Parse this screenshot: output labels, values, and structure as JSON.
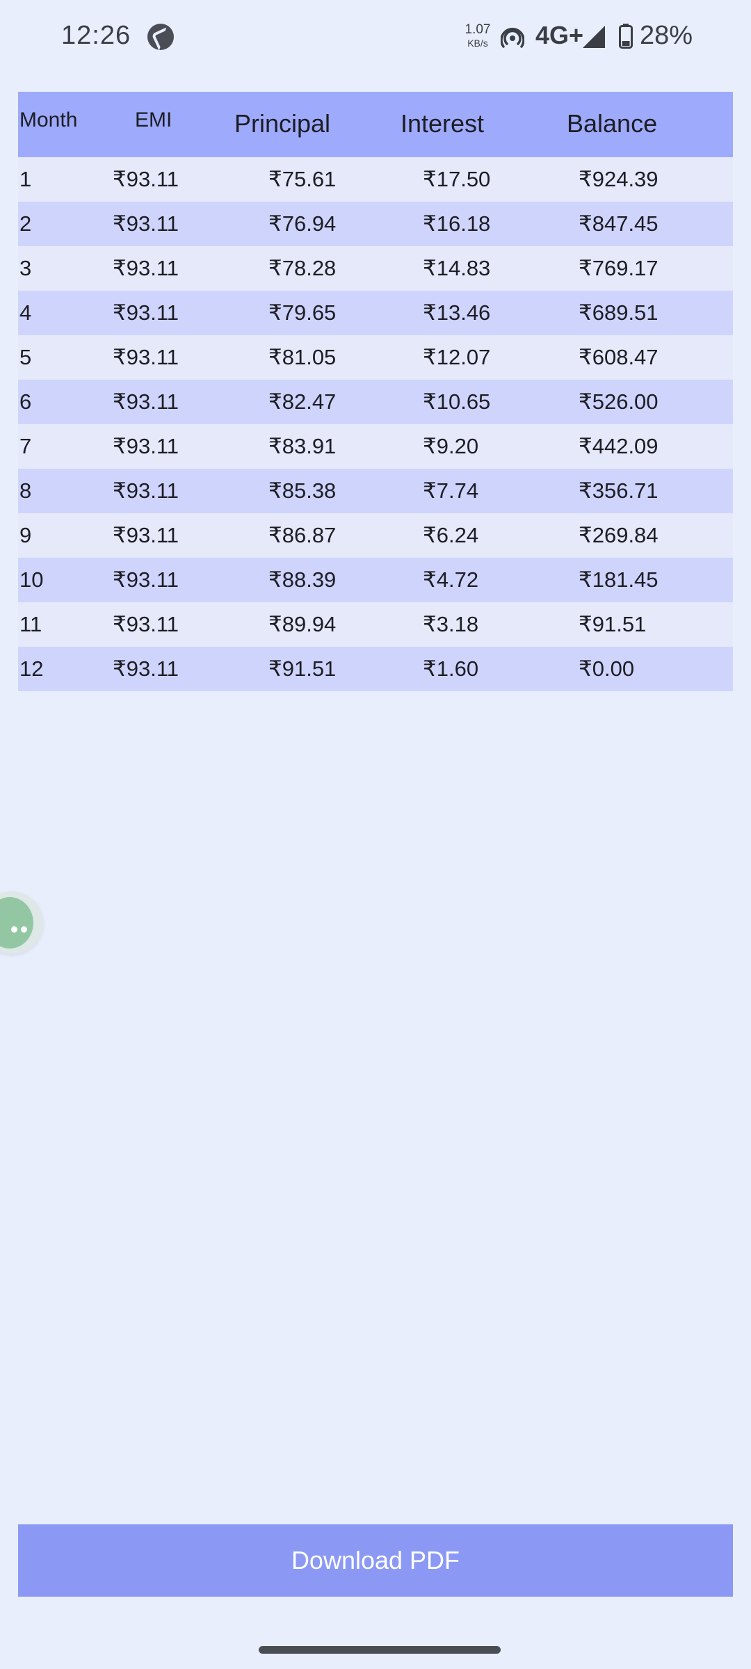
{
  "status_bar": {
    "time": "12:26",
    "net_speed_value": "1.07",
    "net_speed_unit": "KB/s",
    "network_type": "4G+",
    "battery_percent": "28%",
    "icons": [
      "call-app-icon",
      "hotspot-icon",
      "signal-icon",
      "battery-icon"
    ]
  },
  "table": {
    "headers": [
      "Month",
      "EMI",
      "Principal",
      "Interest",
      "Balance"
    ],
    "rows": [
      {
        "month": "1",
        "emi": "₹93.11",
        "principal": "₹75.61",
        "interest": "₹17.50",
        "balance": "₹924.39"
      },
      {
        "month": "2",
        "emi": "₹93.11",
        "principal": "₹76.94",
        "interest": "₹16.18",
        "balance": "₹847.45"
      },
      {
        "month": "3",
        "emi": "₹93.11",
        "principal": "₹78.28",
        "interest": "₹14.83",
        "balance": "₹769.17"
      },
      {
        "month": "4",
        "emi": "₹93.11",
        "principal": "₹79.65",
        "interest": "₹13.46",
        "balance": "₹689.51"
      },
      {
        "month": "5",
        "emi": "₹93.11",
        "principal": "₹81.05",
        "interest": "₹12.07",
        "balance": "₹608.47"
      },
      {
        "month": "6",
        "emi": "₹93.11",
        "principal": "₹82.47",
        "interest": "₹10.65",
        "balance": "₹526.00"
      },
      {
        "month": "7",
        "emi": "₹93.11",
        "principal": "₹83.91",
        "interest": "₹9.20",
        "balance": "₹442.09"
      },
      {
        "month": "8",
        "emi": "₹93.11",
        "principal": "₹85.38",
        "interest": "₹7.74",
        "balance": "₹356.71"
      },
      {
        "month": "9",
        "emi": "₹93.11",
        "principal": "₹86.87",
        "interest": "₹6.24",
        "balance": "₹269.84"
      },
      {
        "month": "10",
        "emi": "₹93.11",
        "principal": "₹88.39",
        "interest": "₹4.72",
        "balance": "₹181.45"
      },
      {
        "month": "11",
        "emi": "₹93.11",
        "principal": "₹89.94",
        "interest": "₹3.18",
        "balance": "₹91.51"
      },
      {
        "month": "12",
        "emi": "₹93.11",
        "principal": "₹91.51",
        "interest": "₹1.60",
        "balance": "₹0.00"
      }
    ]
  },
  "floating_bubble": {
    "icon": "more-dots-icon"
  },
  "actions": {
    "download_label": "Download PDF"
  },
  "colors": {
    "background": "#e9eefc",
    "header": "#9eaafb",
    "row_light": "#e5e9fa",
    "row_dark": "#cfd4fc",
    "button": "#8b99f5",
    "bubble": "#93c7a4"
  }
}
